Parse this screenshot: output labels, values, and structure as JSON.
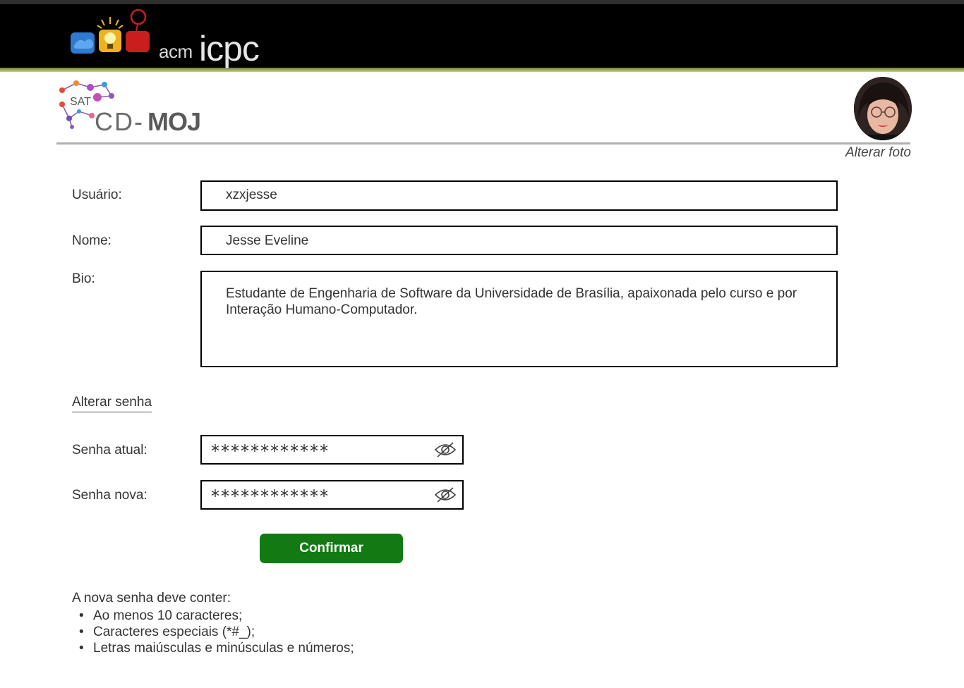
{
  "banner": {
    "acm_label": "acm",
    "icpc_label": "icpc"
  },
  "site": {
    "logo_sat": "SAT",
    "logo_cd": "CD-",
    "logo_moj": "MOJ"
  },
  "profile": {
    "change_photo_label": "Alterar foto"
  },
  "form": {
    "username_label": "Usuário:",
    "username_value": "xzxjesse",
    "name_label": "Nome:",
    "name_value": "Jesse Eveline",
    "bio_label": "Bio:",
    "bio_value": "Estudante de Engenharia de Software da Universidade de Brasília, apaixonada pelo curso e por Interação Humano-Computador."
  },
  "password": {
    "section_link": "Alterar senha",
    "current_label": "Senha atual:",
    "current_value": "************",
    "new_label": "Senha nova:",
    "new_value": "************",
    "toggle_icon": "eye-slash-icon",
    "confirm_label": "Confirmar"
  },
  "rules": {
    "title": "A nova senha deve conter:",
    "items": [
      "Ao menos 10 caracteres;",
      "Caracteres especiais (*#_);",
      "Letras maiúsculas e minúsculas e números;"
    ]
  },
  "colors": {
    "confirm_button": "#137a13",
    "banner": "#000000",
    "banner_accent": "#8a9a45"
  }
}
